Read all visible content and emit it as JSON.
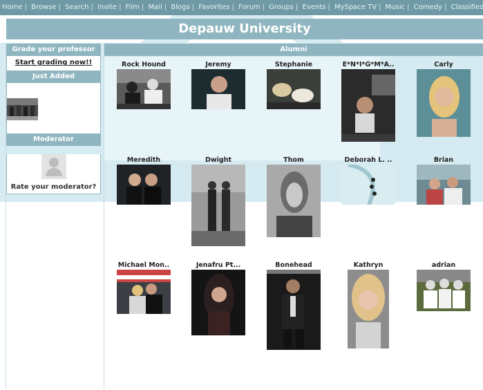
{
  "nav": {
    "items": [
      "Home",
      "Browse",
      "Search",
      "Invite",
      "Film",
      "Mail",
      "Blogs",
      "Favorites",
      "Forum",
      "Groups",
      "Events",
      "MySpace TV",
      "Music",
      "Comedy",
      "Classifieds"
    ]
  },
  "banner": {
    "title": "Depauw University"
  },
  "sidebar": {
    "grade_header": "Grade your professor",
    "grade_link": "Start grading now!!",
    "just_added_header": "Just Added",
    "moderator_header": "Moderator",
    "moderator_rate": "Rate your moderator?"
  },
  "alumni": {
    "header": "Alumni",
    "people": [
      {
        "name": "Rock Hound"
      },
      {
        "name": "Jeremy"
      },
      {
        "name": "Stephanie"
      },
      {
        "name": "E*N*I*G*M*A.."
      },
      {
        "name": "Carly"
      },
      {
        "name": "Meredith"
      },
      {
        "name": "Dwight"
      },
      {
        "name": "Thom"
      },
      {
        "name": "Deborah L. .."
      },
      {
        "name": "Brian"
      },
      {
        "name": "Michael Mon.."
      },
      {
        "name": "Jenafru Pt..."
      },
      {
        "name": "Bonehead"
      },
      {
        "name": "Kathryn"
      },
      {
        "name": "adrian"
      }
    ]
  },
  "colors": {
    "nav_bg": "#6f9aa5",
    "header_bg": "#8fb6c0",
    "watermark": "#d6ebf1"
  }
}
